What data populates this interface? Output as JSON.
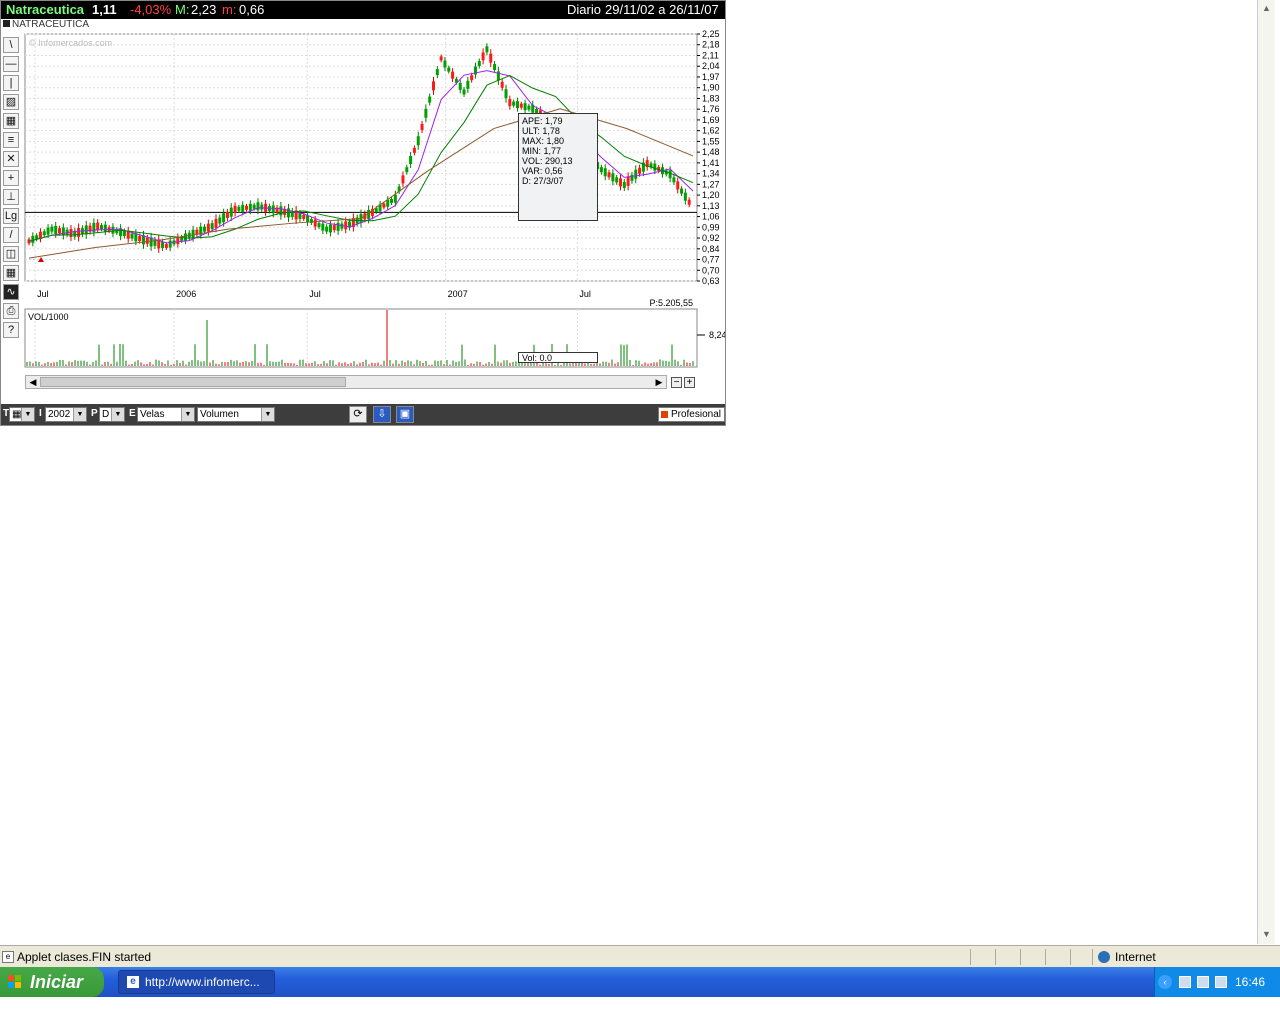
{
  "header": {
    "name": "Natraceutica",
    "last": "1,11",
    "change": "-4,03%",
    "max_label": "M:",
    "max": "2,23",
    "min_label": "m:",
    "min": "0,66",
    "period": "Diario",
    "range": "29/11/02 a 26/11/07"
  },
  "subtitle": "NATRACEUTICA",
  "watermark": "© Infomercados.com",
  "toolbar": [
    "\\",
    "—",
    "|",
    "▨",
    "▦",
    "≡",
    "✕",
    "+",
    "⊥",
    "Lg",
    "/",
    "◫",
    "▦",
    "∿",
    "⎙",
    "?"
  ],
  "price_axis": [
    "2,25",
    "2,18",
    "2,11",
    "2,04",
    "1,97",
    "1,90",
    "1,83",
    "1,76",
    "1,69",
    "1,62",
    "1,55",
    "1,48",
    "1,41",
    "1,34",
    "1,27",
    "1,20",
    "1,13",
    "1,06",
    "0,99",
    "0,92",
    "0,84",
    "0,77",
    "0,70",
    "0,63"
  ],
  "time_axis": [
    {
      "label": "Jul",
      "pos": 0.015
    },
    {
      "label": "2006",
      "pos": 0.222
    },
    {
      "label": "Jul",
      "pos": 0.42
    },
    {
      "label": "2007",
      "pos": 0.626
    },
    {
      "label": "Jul",
      "pos": 0.822
    }
  ],
  "p_label": "P:5.205,55",
  "volume": {
    "title": "VOL/1000",
    "axis_value": "8,24",
    "tooltip": "Vol: 0.0"
  },
  "tooltip": [
    "APE: 1,79",
    "ULT: 1,78",
    "MAX: 1,80",
    "MIN: 1,77",
    "VOL: 290,13",
    "VAR: 0,56",
    "D: 27/3/07"
  ],
  "controls": {
    "t_label": "T",
    "i_label": "I",
    "year": "2002",
    "p_label": "P",
    "period": "D",
    "e_label": "E",
    "style": "Velas",
    "indicator": "Volumen",
    "mode": "Profesional"
  },
  "chart_data": {
    "type": "line",
    "title": "Natraceutica",
    "series": [
      {
        "name": "",
        "x": [
          "2005-06",
          "2005-07",
          "2005-08",
          "2005-09",
          "2005-10",
          "2005-11",
          "2005-12",
          "2006-01",
          "2006-02",
          "2006-03",
          "2006-04",
          "2006-05",
          "2006-06",
          "2006-07",
          "2006-08",
          "2006-09",
          "2006-10",
          "2006-11",
          "2006-12",
          "2007-01",
          "2007-02",
          "2007-03",
          "2007-04",
          "2007-05",
          "2007-06",
          "2007-07",
          "2007-08",
          "2007-09",
          "2007-10",
          "2007-11"
        ],
        "values": [
          0.89,
          0.97,
          0.94,
          0.99,
          0.95,
          0.9,
          0.86,
          0.93,
          0.99,
          1.1,
          1.12,
          1.09,
          1.05,
          0.97,
          1.0,
          1.08,
          1.17,
          1.55,
          2.09,
          1.87,
          2.15,
          1.8,
          1.76,
          1.65,
          1.52,
          1.36,
          1.26,
          1.4,
          1.33,
          1.11
        ]
      },
      {
        "name": "",
        "x": [
          "2005-06",
          "2005-09",
          "2005-12",
          "2006-03",
          "2006-06",
          "2006-09",
          "2006-12",
          "2007-03",
          "2007-06",
          "2007-09",
          "2007-11"
        ],
        "values": [
          0.78,
          0.85,
          0.9,
          0.97,
          1.01,
          1.04,
          1.35,
          1.63,
          1.76,
          1.63,
          1.45
        ]
      }
    ],
    "ylim": [
      0.63,
      2.25
    ],
    "grid": true,
    "legend": "none"
  }
}
